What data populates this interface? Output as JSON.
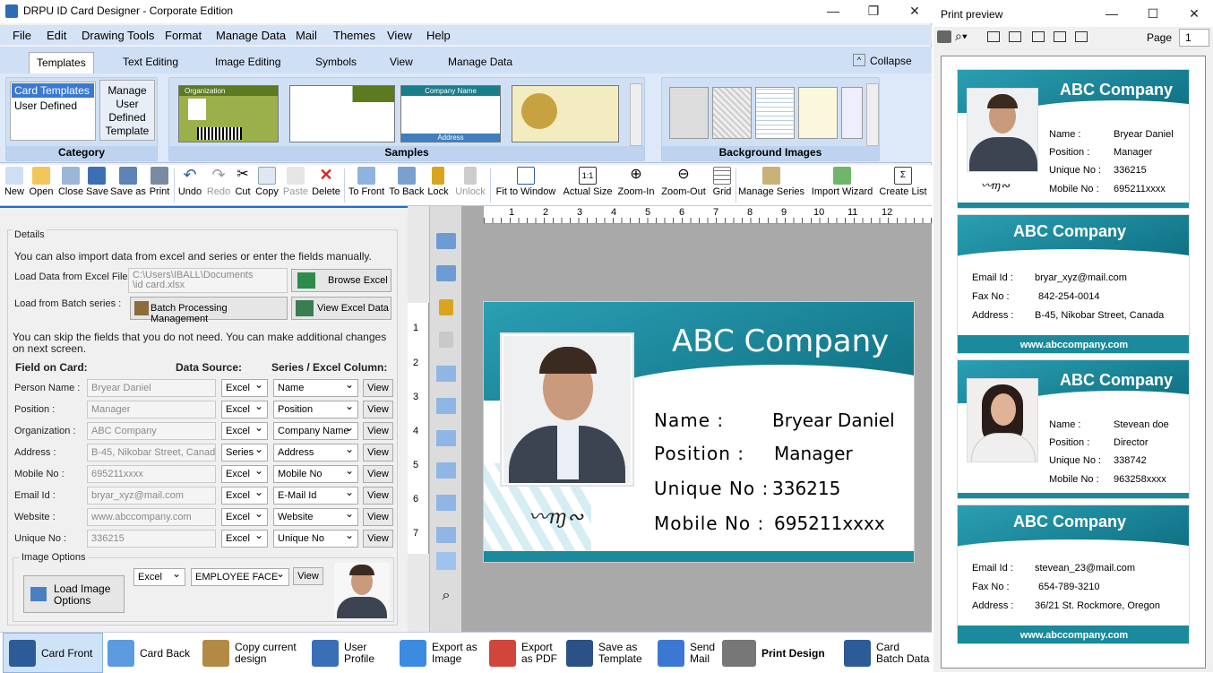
{
  "app": {
    "title": "DRPU ID Card Designer - Corporate Edition"
  },
  "menu": [
    "File",
    "Edit",
    "Drawing Tools",
    "Format",
    "Manage Data",
    "Mail",
    "Themes",
    "View",
    "Help"
  ],
  "ribbon_tabs": [
    "Templates",
    "Text Editing",
    "Image Editing",
    "Symbols",
    "View",
    "Manage Data"
  ],
  "collapse": "Collapse",
  "category": {
    "items": [
      "Card Templates",
      "User Defined"
    ],
    "manage": "Manage User Defined Template",
    "label": "Category"
  },
  "samples": {
    "label": "Samples",
    "s1": "Organization",
    "s3": "Company Name",
    "s3b": "Address"
  },
  "background": {
    "label": "Background Images"
  },
  "toolbar": [
    "New",
    "Open",
    "Close",
    "Save",
    "Save as",
    "Print",
    "Undo",
    "Redo",
    "Cut",
    "Copy",
    "Paste",
    "Delete",
    "To Front",
    "To Back",
    "Lock",
    "Unlock",
    "Fit to Window",
    "Actual Size",
    "Zoom-In",
    "Zoom-Out",
    "Grid",
    "Manage Series",
    "Import Wizard",
    "Create List"
  ],
  "details": {
    "legend": "Details",
    "intro": "You can also import data from excel and series or enter the fields manually.",
    "load_excel_label": "Load Data from Excel File :",
    "excel_path1": "C:\\Users\\IBALL\\Documents",
    "excel_path2": "\\id card.xlsx",
    "browse": "Browse Excel",
    "load_batch_label": "Load from Batch series :",
    "batch": "Batch Processing Management",
    "view_excel": "View Excel Data",
    "skip": "You can skip the fields that you do not need.  You can make additional changes on next screen.",
    "h_field": "Field on Card:",
    "h_source": "Data Source:",
    "h_column": "Series / Excel Column:",
    "rows": [
      {
        "label": "Person Name :",
        "value": "Bryear Daniel",
        "source": "Excel",
        "column": "Name",
        "view": "View"
      },
      {
        "label": "Position :",
        "value": "Manager",
        "source": "Excel",
        "column": "Position",
        "view": "View"
      },
      {
        "label": "Organization :",
        "value": "ABC Company",
        "source": "Excel",
        "column": "Company Name",
        "view": "View"
      },
      {
        "label": "Address :",
        "value": "B-45, Nikobar Street, Canada",
        "source": "Series",
        "column": "Address",
        "view": "View"
      },
      {
        "label": "Mobile No :",
        "value": "695211xxxx",
        "source": "Excel",
        "column": "Mobile No",
        "view": "View"
      },
      {
        "label": "Email Id :",
        "value": "bryar_xyz@mail.com",
        "source": "Excel",
        "column": "E-Mail Id",
        "view": "View"
      },
      {
        "label": "Website :",
        "value": "www.abccompany.com",
        "source": "Excel",
        "column": "Website",
        "view": "View"
      },
      {
        "label": "Unique No :",
        "value": "336215",
        "source": "Excel",
        "column": "Unique No",
        "view": "View"
      }
    ],
    "image_options": "Image Options",
    "load_image": "Load Image Options",
    "img_source": "Excel",
    "img_column": "EMPLOYEE FACE",
    "img_view": "View"
  },
  "card": {
    "company": "ABC Company",
    "rows": [
      [
        "Name :",
        "Bryear Daniel"
      ],
      [
        "Position :",
        "Manager"
      ],
      [
        "Unique No :",
        "336215"
      ],
      [
        "Mobile No :",
        "695211xxxx"
      ]
    ]
  },
  "ruler": [
    "1",
    "2",
    "3",
    "4",
    "5",
    "6",
    "7",
    "8",
    "9",
    "10",
    "11",
    "12"
  ],
  "vruler": [
    "1",
    "2",
    "3",
    "4",
    "5",
    "6",
    "7"
  ],
  "bottom": [
    "Card Front",
    "Card Back",
    "Copy current design",
    "User Profile",
    "Export as Image",
    "Export as PDF",
    "Save as Template",
    "Send Mail",
    "Print Design",
    "Card Batch Data"
  ],
  "preview": {
    "title": "Print preview",
    "page_label": "Page",
    "page": "1",
    "cards": [
      {
        "type": "front",
        "company": "ABC Company",
        "rows": [
          [
            "Name :",
            "Bryear Daniel"
          ],
          [
            "Position :",
            "Manager"
          ],
          [
            "Unique No :",
            "336215"
          ],
          [
            "Mobile No :",
            "695211xxxx"
          ]
        ]
      },
      {
        "type": "back",
        "company": "ABC Company",
        "rows": [
          [
            "Email Id :",
            "bryar_xyz@mail.com"
          ],
          [
            "Fax No :",
            "842-254-0014"
          ],
          [
            "Address :",
            "B-45, Nikobar Street, Canada"
          ]
        ],
        "web": "www.abccompany.com"
      },
      {
        "type": "front",
        "company": "ABC Company",
        "rows": [
          [
            "Name :",
            "Stevean doe"
          ],
          [
            "Position :",
            "Director"
          ],
          [
            "Unique No :",
            "338742"
          ],
          [
            "Mobile No :",
            "963258xxxx"
          ]
        ]
      },
      {
        "type": "back",
        "company": "ABC Company",
        "rows": [
          [
            "Email Id :",
            "stevean_23@mail.com"
          ],
          [
            "Fax No :",
            "654-789-3210"
          ],
          [
            "Address :",
            "36/21 St. Rockmore, Oregon"
          ]
        ],
        "web": "www.abccompany.com"
      }
    ]
  },
  "colors": {
    "teal": "#1a8a9c",
    "ribbon": "#dde9f8",
    "accent": "#1e6fd0"
  }
}
